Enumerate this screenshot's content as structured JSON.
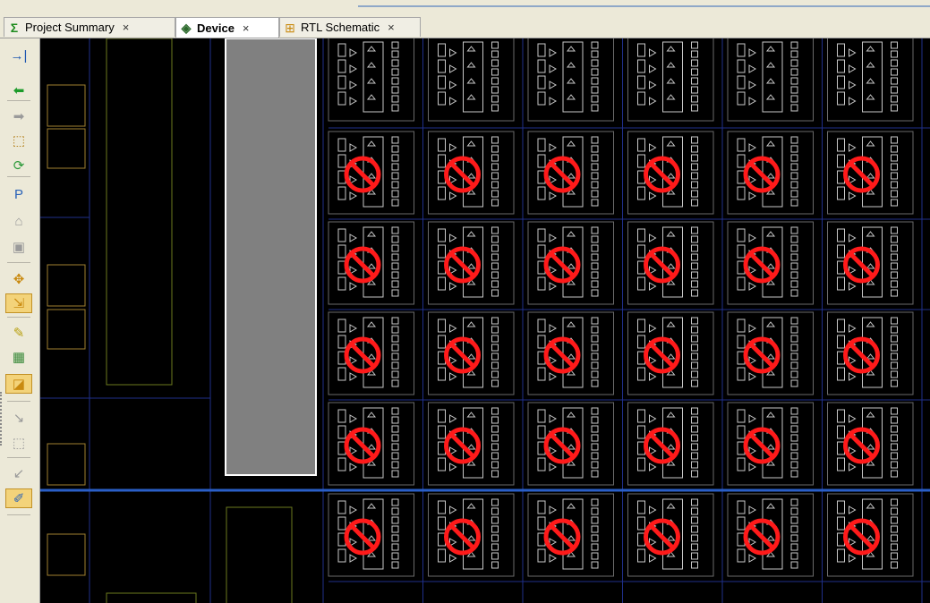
{
  "tabs": [
    {
      "label": "Project Summary",
      "icon": "sigma-icon",
      "icon_glyph": "Σ",
      "close": "×",
      "active": false
    },
    {
      "label": "Device",
      "icon": "device-chip-icon",
      "icon_glyph": "◈",
      "close": "×",
      "active": true
    },
    {
      "label": "RTL Schematic",
      "icon": "schematic-icon",
      "icon_glyph": "⊞",
      "close": "×",
      "active": false
    }
  ],
  "toolbar": [
    {
      "name": "expand-icon",
      "glyph": "→|",
      "color": "#1d56b0",
      "active": false
    },
    {
      "name": "back-arrow-icon",
      "glyph": "⬅",
      "color": "#1c9b2a",
      "active": false
    },
    {
      "name": "forward-arrow-icon",
      "glyph": "➡",
      "color": "#9a9a9a",
      "active": false
    },
    {
      "name": "select-area-icon",
      "glyph": "⬚",
      "color": "#b07a10",
      "active": false
    },
    {
      "name": "refresh-route-icon",
      "glyph": "⟳",
      "color": "#2d9a3a",
      "active": false
    },
    {
      "name": "add-pblock-icon",
      "glyph": "P",
      "color": "#2a63b8",
      "active": false
    },
    {
      "name": "house-icon",
      "glyph": "⌂",
      "color": "#9a9a9a",
      "active": false
    },
    {
      "name": "cell-icon",
      "glyph": "▣",
      "color": "#9a9a9a",
      "active": false
    },
    {
      "name": "fit-icon",
      "glyph": "✥",
      "color": "#c98a10",
      "active": false
    },
    {
      "name": "placement-icon",
      "glyph": "⇲",
      "color": "#c98a10",
      "active": true
    },
    {
      "name": "highlight-icon",
      "glyph": "✎",
      "color": "#b8a010",
      "active": false
    },
    {
      "name": "grid-view-icon",
      "glyph": "▦",
      "color": "#3a8a3a",
      "active": false
    },
    {
      "name": "show-routing-icon",
      "glyph": "◪",
      "color": "#c98a10",
      "active": true
    },
    {
      "name": "collapse-icon",
      "glyph": "↘",
      "color": "#9a9a9a",
      "active": false
    },
    {
      "name": "zoom-area-icon",
      "glyph": "⬚",
      "color": "#9a9a9a",
      "active": false
    },
    {
      "name": "shrink-icon",
      "glyph": "↙",
      "color": "#9a9a9a",
      "active": false
    },
    {
      "name": "marker-icon",
      "glyph": "✐",
      "color": "#2a63b8",
      "active": true
    }
  ],
  "device_view": {
    "tile_columns": 6,
    "tile_rows": 6,
    "prohibit_rows": [
      false,
      true,
      true,
      true,
      true,
      true
    ],
    "colors": {
      "background": "#000000",
      "grid_line": "#1f2f8a",
      "tile_border": "#6a6a6a",
      "tile_element": "#c8c8c8",
      "prohibit": "#ff1a1a",
      "clock_region_line": "#2a5fc8",
      "block_fill": "#808080",
      "block_border": "#ffffff",
      "io_outline": "#6c7a1e",
      "pad_outline": "#a08030"
    }
  }
}
